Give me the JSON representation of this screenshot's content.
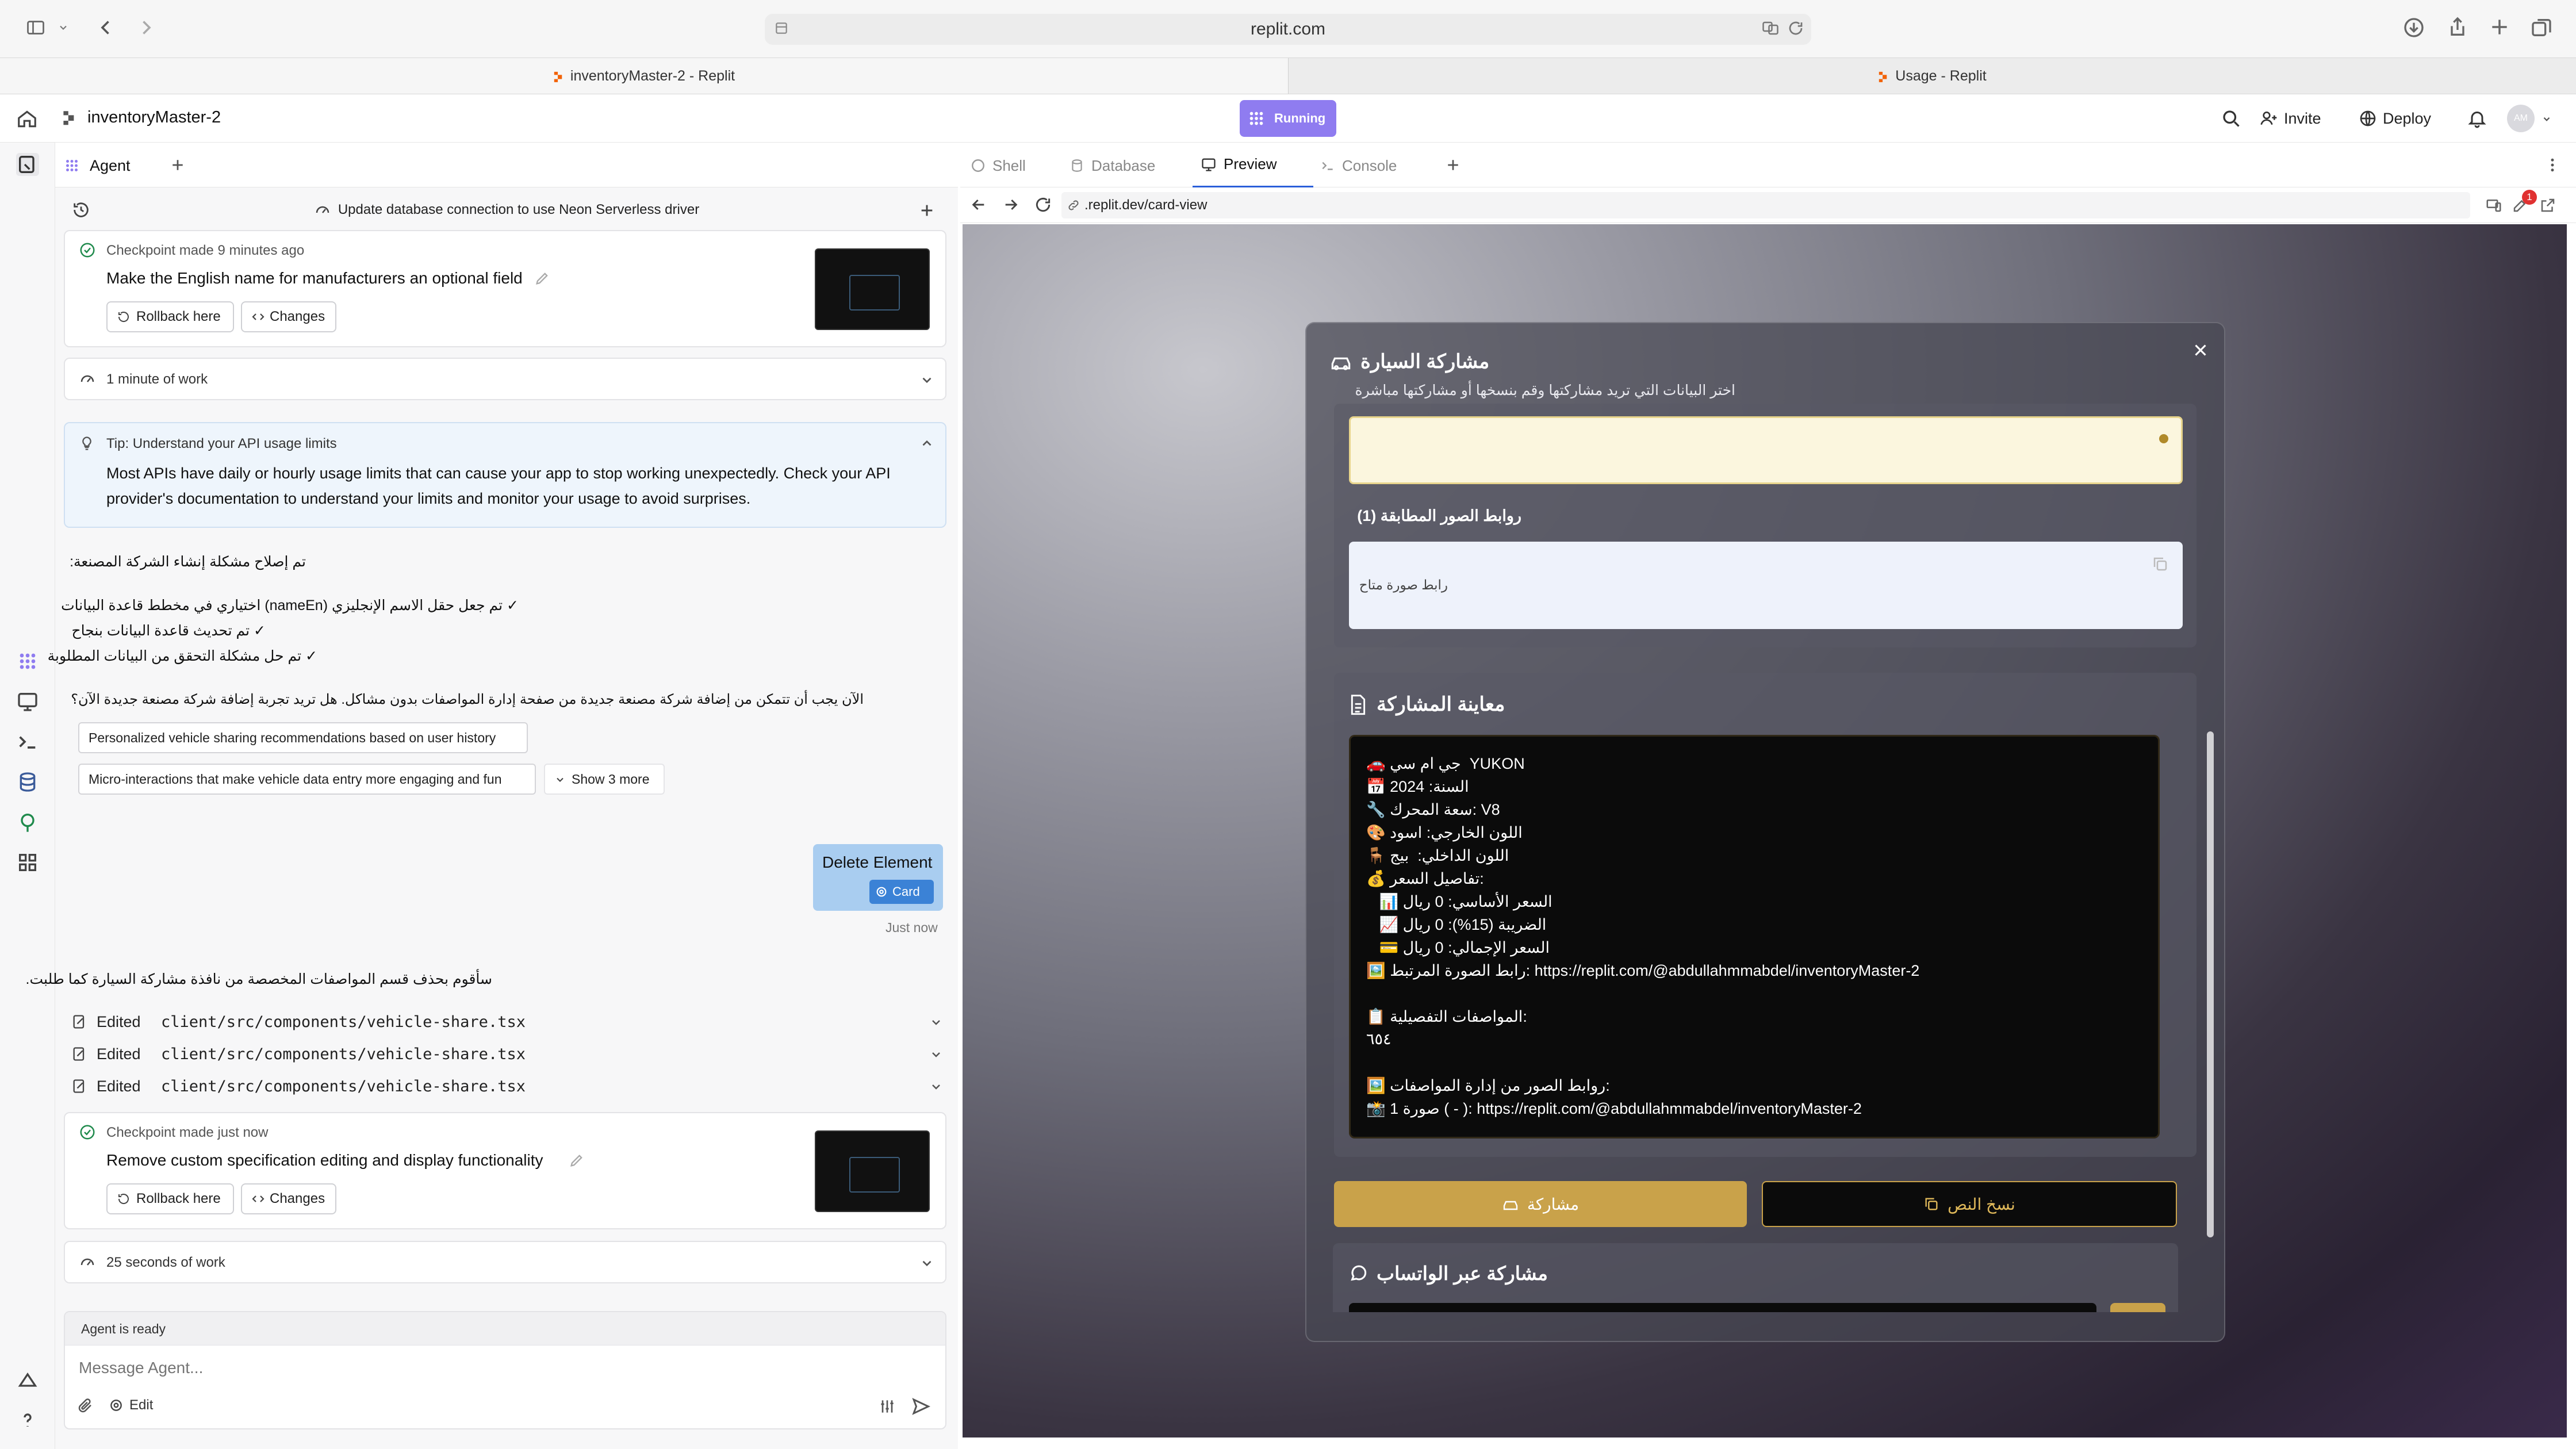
{
  "browser": {
    "url": "replit.com",
    "tabs": [
      "inventoryMaster-2 - Replit",
      "Usage - Replit"
    ]
  },
  "header": {
    "project": "inventoryMaster-2",
    "status": "Running",
    "invite": "Invite",
    "deploy": "Deploy",
    "avatar": "AM"
  },
  "agent": {
    "tab": "Agent",
    "thread_title": "Update database connection to use Neon Serverless driver",
    "checkpoint1": {
      "meta": "Checkpoint made 9 minutes ago",
      "title": "Make the English name for manufacturers an optional field",
      "rollback": "Rollback here",
      "changes": "Changes"
    },
    "work1": "1 minute of work",
    "tip": {
      "title": "Tip: Understand your API usage limits",
      "body1": "Most APIs have daily or hourly usage limits that can cause your app to stop working unexpectedly. Check your API",
      "body2": "provider's documentation to understand your limits and monitor your usage to avoid surprises."
    },
    "msg": {
      "l1": "تم إصلاح مشكلة إنشاء الشركة المصنعة:",
      "l2": "✓ تم جعل حقل الاسم الإنجليزي (nameEn) اختياري في مخطط قاعدة البيانات",
      "l3": "✓ تم تحديث قاعدة البيانات بنجاح",
      "l4": "✓ تم حل مشكلة التحقق من البيانات المطلوبة",
      "l5": "الآن يجب أن تتمكن من إضافة شركة مصنعة جديدة من صفحة إدارة المواصفات بدون مشاكل. هل تريد تجربة إضافة شركة مصنعة جديدة الآن؟"
    },
    "suggestions": [
      "Personalized vehicle sharing recommendations based on user history",
      "Micro-interactions that make vehicle data entry more engaging and fun",
      "Show 3 more"
    ],
    "user_msg": {
      "text": "Delete Element",
      "tag": "Card",
      "time": "Just now"
    },
    "reply": "سأقوم بحذف قسم المواصفات المخصصة من نافذة مشاركة السيارة كما طلبت.",
    "edits": [
      {
        "label": "Edited",
        "file": "client/src/components/vehicle-share.tsx"
      },
      {
        "label": "Edited",
        "file": "client/src/components/vehicle-share.tsx"
      },
      {
        "label": "Edited",
        "file": "client/src/components/vehicle-share.tsx"
      }
    ],
    "checkpoint2": {
      "meta": "Checkpoint made just now",
      "title": "Remove custom specification editing and display functionality",
      "rollback": "Rollback here",
      "changes": "Changes"
    },
    "work2": "25 seconds of work",
    "ready": "Agent is ready",
    "input_placeholder": "Message Agent...",
    "edit": "Edit"
  },
  "panes": {
    "tabs": [
      "Shell",
      "Database",
      "Preview",
      "Console"
    ],
    "url": ".replit.dev/card-view",
    "badge": "1"
  },
  "modal": {
    "title": "مشاركة السيارة",
    "subtitle": "اختر البيانات التي تريد مشاركتها وقم بنسخها أو مشاركتها مباشرة",
    "images_label": "روابط الصور المطابقة (1)",
    "image_link": "رابط صورة متاح",
    "preview_title": "معاينة المشاركة",
    "lines": [
      "🚗 جي ام سي  YUKON",
      "📅 السنة: 2024",
      "🔧 سعة المحرك: V8",
      "🎨 اللون الخارجي: اسود",
      "🪑 اللون الداخلي:  بيج",
      "💰 تفاصيل السعر:",
      "   📊 السعر الأساسي: 0 ريال",
      "   📈 الضريبة (15%): 0 ريال",
      "   💳 السعر الإجمالي: 0 ريال",
      "🖼️ رابط الصورة المرتبط: https://replit.com/@abdullahmmabdel/inventoryMaster-2",
      "",
      "📋 المواصفات التفصيلية:",
      "٦٥٤",
      "",
      "🖼️ روابط الصور من إدارة المواصفات:",
      "📸 صورة 1 ( - ): https://replit.com/@abdullahmmabdel/inventoryMaster-2"
    ],
    "share": "مشاركة",
    "copy": "نسخ النص",
    "whatsapp": "مشاركة عبر الواتساب"
  },
  "colors": {
    "accent": "#c9a24a",
    "replit_orange": "#f26207",
    "running_bg": "#8f7cf0"
  }
}
